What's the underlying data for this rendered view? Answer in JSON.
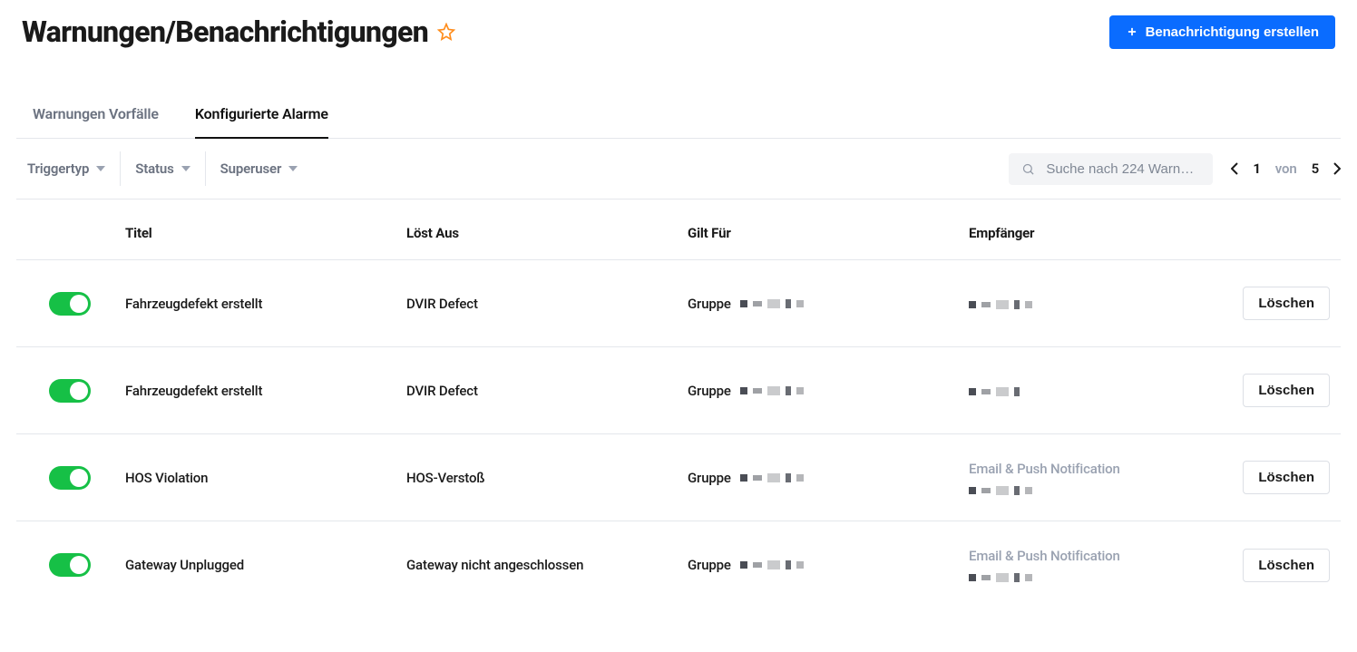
{
  "header": {
    "title": "Warnungen/Benachrichtigungen",
    "create_button_label": "Benachrichtigung erstellen"
  },
  "tabs": [
    {
      "label": "Warnungen Vorfälle",
      "active": false
    },
    {
      "label": "Konfigurierte Alarme",
      "active": true
    }
  ],
  "filters": [
    {
      "label": "Triggertyp"
    },
    {
      "label": "Status"
    },
    {
      "label": "Superuser"
    }
  ],
  "search": {
    "placeholder": "Suche nach 224 Warnungen"
  },
  "pagination": {
    "current": "1",
    "of_label": "von",
    "total": "5"
  },
  "columns": {
    "title": "Titel",
    "triggers": "Löst Aus",
    "applies_to": "Gilt Für",
    "recipients": "Empfänger"
  },
  "labels": {
    "group": "Gruppe",
    "delete": "Löschen",
    "email_push": "Email & Push Notification"
  },
  "rows": [
    {
      "enabled": true,
      "title": "Fahrzeugdefekt erstellt",
      "trigger": "DVIR Defect",
      "applies_label": "Gruppe",
      "recipient_heading": "",
      "show_recipient_heading": false
    },
    {
      "enabled": true,
      "title": "Fahrzeugdefekt erstellt",
      "trigger": "DVIR Defect",
      "applies_label": "Gruppe",
      "recipient_heading": "",
      "show_recipient_heading": false
    },
    {
      "enabled": true,
      "title": "HOS Violation",
      "trigger": "HOS-Verstoß",
      "applies_label": "Gruppe",
      "recipient_heading": "Email & Push Notification",
      "show_recipient_heading": true
    },
    {
      "enabled": true,
      "title": "Gateway Unplugged",
      "trigger": "Gateway nicht angeschlossen",
      "applies_label": "Gruppe",
      "recipient_heading": "Email & Push Notification",
      "show_recipient_heading": true
    }
  ]
}
